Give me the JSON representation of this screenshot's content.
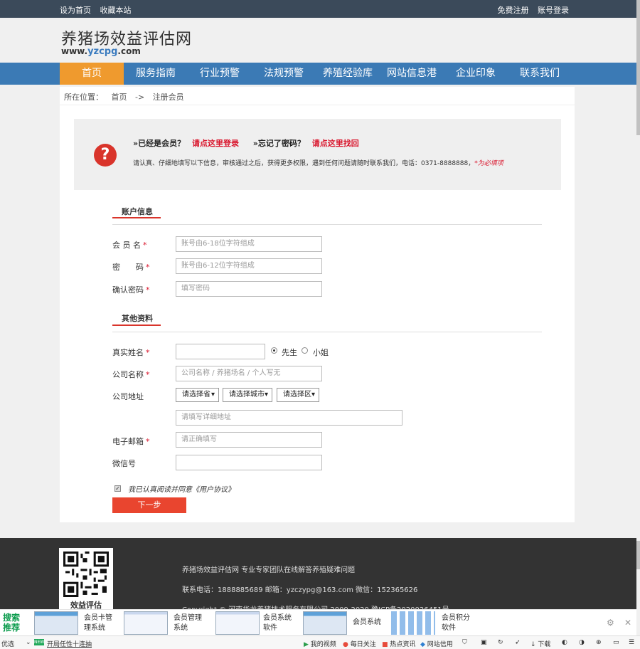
{
  "topbar": {
    "left": [
      "设为首页",
      "收藏本站"
    ],
    "right": [
      "免费注册",
      "账号登录"
    ]
  },
  "header": {
    "title": "养猪场效益评估网",
    "url_prefix": "www.",
    "url_highlight": "yzcpg",
    "url_suffix": ".com"
  },
  "nav": {
    "items": [
      "首页",
      "服务指南",
      "行业预警",
      "法规预警",
      "养殖经验库",
      "网站信息港",
      "企业印象",
      "联系我们"
    ]
  },
  "breadcrumb": {
    "label": "所在位置：",
    "home": "首页",
    "sep": "->",
    "current": "注册会员"
  },
  "notice": {
    "q1": "»已经是会员？",
    "q1_link": "请点这里登录",
    "q2": "»忘记了密码？",
    "q2_link": "请点这里找回",
    "desc": "请认真、仔细地填写以下信息，审核通过之后，获得更多权限，遇到任何问题请随时联系我们，电话：0371-8888888，",
    "required_note": "*为必填项"
  },
  "account_section": {
    "title": "账户信息",
    "username_label": "会 员 名",
    "username_placeholder": "账号由6-18位字符组成",
    "password_label": "密　　码",
    "password_placeholder": "账号由6-12位字符组成",
    "confirm_label": "确认密码",
    "confirm_placeholder": "填写密码"
  },
  "other_section": {
    "title": "其他资料",
    "realname_label": "真实姓名",
    "realname_value": "",
    "gender_male": "先生",
    "gender_female": "小姐",
    "company_label": "公司名称",
    "company_placeholder": "公司名称 / 养猪场名 / 个人写无",
    "address_label": "公司地址",
    "province": "请选择省",
    "city": "请选择城市",
    "district": "请选择区",
    "address_placeholder": "请填写详细地址",
    "email_label": "电子邮箱",
    "email_placeholder": "请正确填写",
    "wechat_label": "微信号",
    "wechat_value": ""
  },
  "agree_text": "我已认真阅读并同意《用户协议》",
  "next_button": "下一步",
  "required_mark": "*",
  "footer": {
    "qr_caption": "效益评估",
    "slogan": "养猪场效益评估网 专业专家团队在线解答养殖疑难问题",
    "contact": "联系电话：1888885689 邮箱：yzczypg@163.com 微信：152365626",
    "copyright": "Copyright © 河南华龙养猪技术服务有限公司 2009-2020 豫ICP备2020026451号"
  },
  "adbar": {
    "tag_line1": "搜索",
    "tag_line2": "推荐",
    "items": [
      {
        "l1": "会员卡管",
        "l2": "理系统"
      },
      {
        "l1": "会员管理",
        "l2": "系统"
      },
      {
        "l1": "会员系统",
        "l2": "软件"
      },
      {
        "l1": "会员系统",
        "l2": ""
      },
      {
        "l1": "会员积分",
        "l2": "软件"
      }
    ]
  },
  "statusbar": {
    "left1": "优选",
    "new_badge": "NEW",
    "left2": "开局任性十连抽",
    "items": [
      "我的视频",
      "每日关注",
      "热点资讯",
      "网站信用",
      "下载"
    ]
  }
}
